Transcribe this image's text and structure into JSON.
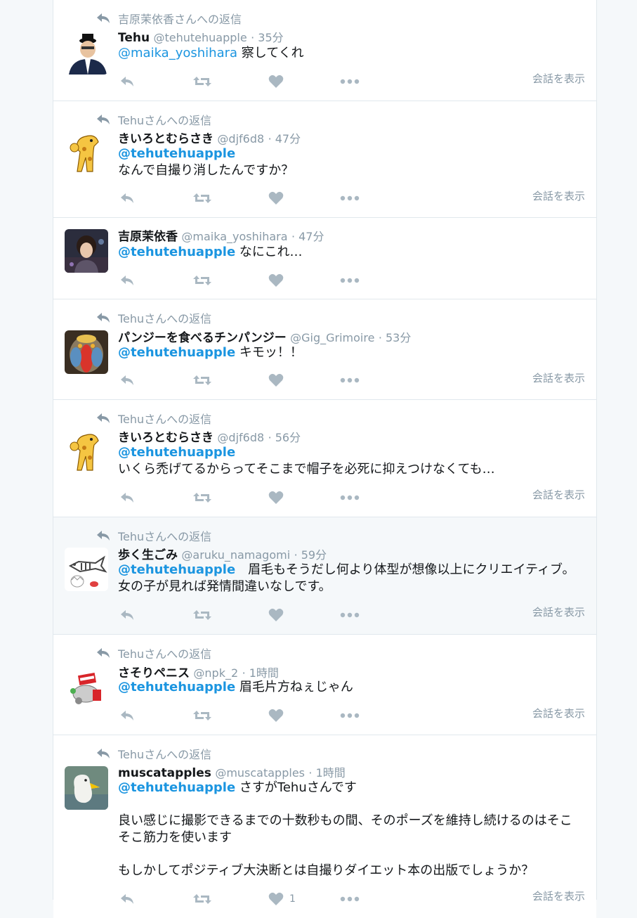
{
  "show_conversation_label": "会話を表示",
  "tweets": [
    {
      "context": "吉原茉依香さんへの返信",
      "name": "Tehu",
      "handle": "@tehutehuapple",
      "time": "· 35分",
      "mention": "@maika_yoshihara",
      "text": " 察してくれ"
    },
    {
      "context": "Tehuさんへの返信",
      "name": "きいろとむらさき",
      "handle": "@djf6d8",
      "time": "· 47分",
      "mention": "@tehutehuapple",
      "text": "なんで自撮り消したんですか？"
    },
    {
      "name": "吉原茉依香",
      "handle": "@maika_yoshihara",
      "time": "· 47分",
      "mention": "@tehutehuapple",
      "text": " なにこれ…"
    },
    {
      "context": "Tehuさんへの返信",
      "name": "パンジーを食べるチンパンジー",
      "handle": "@Gig_Grimoire",
      "time": "· 53分",
      "mention": "@tehutehuapple",
      "text": " キモッ！！"
    },
    {
      "context": "Tehuさんへの返信",
      "name": "きいろとむらさき",
      "handle": "@djf6d8",
      "time": "· 56分",
      "mention": "@tehutehuapple",
      "text": "いくら禿げてるからってそこまで帽子を必死に抑えつけなくても…"
    },
    {
      "context": "Tehuさんへの返信",
      "name": "歩く生ごみ",
      "handle": "@aruku_namagomi",
      "time": "· 59分",
      "mention": "@tehutehuapple",
      "text": "　眉毛もそうだし何より体型が想像以上にクリエイティブ。女の子が見れば発情間違いなしです。"
    },
    {
      "context": "Tehuさんへの返信",
      "name": "さそりペニス",
      "handle": "@npk_2",
      "time": "· 1時間",
      "mention": "@tehutehuapple",
      "text": " 眉毛片方ねぇじゃん"
    },
    {
      "context": "Tehuさんへの返信",
      "name": "muscatapples",
      "handle": "@muscatapples",
      "time": "· 1時間",
      "mention": "@tehutehuapple",
      "text": " さすがTehuさんです",
      "para2": "良い感じに撮影できるまでの十数秒もの間、そのポーズを維持し続けるのはそこそこ筋力を使います",
      "para3": "もしかしてポジティブ大決断とは自撮りダイエット本の出版でしょうか？",
      "like_count": "1"
    }
  ]
}
